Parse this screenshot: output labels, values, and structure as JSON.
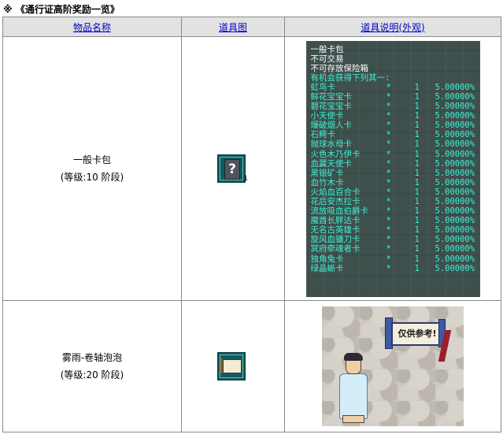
{
  "title": "※ 《通行证高阶奖励一览》",
  "table": {
    "headers": [
      "物品名称",
      "道具图",
      "道具说明(外观)"
    ],
    "rows": [
      {
        "name": "一般卡包",
        "level": "(等级:10 阶段)",
        "icon": "question-mark-card-pack-icon",
        "icon_count": "1",
        "tooltip": {
          "lines": [
            "一般卡包",
            "不可交易",
            "不可存放保险箱"
          ],
          "header": "有机会获得下列其一:",
          "items": [
            {
              "name": "虹鸟卡",
              "star": "*",
              "qty": "1",
              "pct": "5.00000%"
            },
            {
              "name": "鲜花宝宝卡",
              "star": "*",
              "qty": "1",
              "pct": "5.00000%"
            },
            {
              "name": "碧花宝宝卡",
              "star": "*",
              "qty": "1",
              "pct": "5.00000%"
            },
            {
              "name": "小天使卡",
              "star": "*",
              "qty": "1",
              "pct": "5.00000%"
            },
            {
              "name": "爆破烟人卡",
              "star": "*",
              "qty": "1",
              "pct": "5.00000%"
            },
            {
              "name": "石鳄卡",
              "star": "*",
              "qty": "1",
              "pct": "5.00000%"
            },
            {
              "name": "抛球水母卡",
              "star": "*",
              "qty": "1",
              "pct": "5.00000%"
            },
            {
              "name": "火色木乃伊卡",
              "star": "*",
              "qty": "1",
              "pct": "5.00000%"
            },
            {
              "name": "血翼天使卡",
              "star": "*",
              "qty": "1",
              "pct": "5.00000%"
            },
            {
              "name": "黑银矿卡",
              "star": "*",
              "qty": "1",
              "pct": "5.00000%"
            },
            {
              "name": "血竹木卡",
              "star": "*",
              "qty": "1",
              "pct": "5.00000%"
            },
            {
              "name": "火焰血百合卡",
              "star": "*",
              "qty": "1",
              "pct": "5.00000%"
            },
            {
              "name": "花后安杰拉卡",
              "star": "*",
              "qty": "1",
              "pct": "5.00000%"
            },
            {
              "name": "流放吸血伯爵卡",
              "star": "*",
              "qty": "1",
              "pct": "5.00000%"
            },
            {
              "name": "魔酋长胖达卡",
              "star": "*",
              "qty": "1",
              "pct": "5.00000%"
            },
            {
              "name": "无名古英雄卡",
              "star": "*",
              "qty": "1",
              "pct": "5.00000%"
            },
            {
              "name": "旋风血镰刀卡",
              "star": "*",
              "qty": "1",
              "pct": "5.00000%"
            },
            {
              "name": "冥府牵魂者卡",
              "star": "*",
              "qty": "1",
              "pct": "5.00000%"
            },
            {
              "name": "独角兔卡",
              "star": "*",
              "qty": "1",
              "pct": "5.00000%"
            },
            {
              "name": "绿晶蜥卡",
              "star": "*",
              "qty": "1",
              "pct": "5.00000%"
            }
          ]
        }
      },
      {
        "name": "雾雨-卷轴泡泡",
        "level": "(等级:20 阶段)",
        "icon": "scroll-bubble-icon",
        "preview": {
          "sign_text": "仅供参考!"
        }
      }
    ]
  },
  "colors": {
    "header_bg": "#e2e2e2",
    "link": "#0000cc",
    "tooltip_bg": "#3e4f4c",
    "tooltip_text": "#3cf0d4",
    "tooltip_white": "#ffffff"
  }
}
